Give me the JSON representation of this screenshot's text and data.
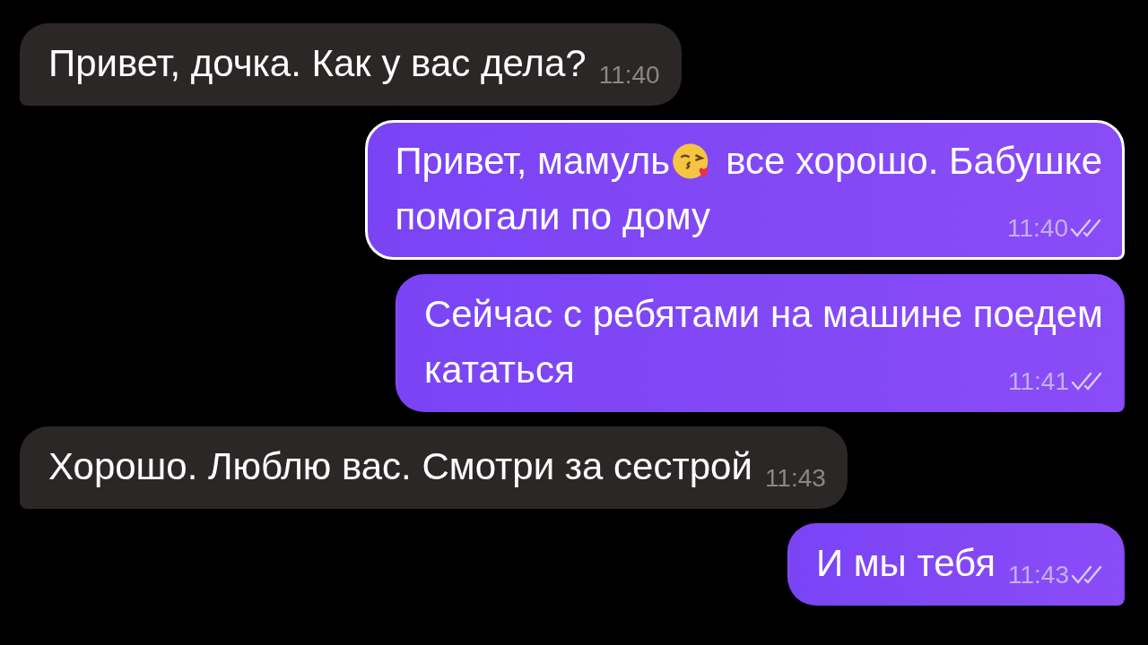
{
  "messages": [
    {
      "kind": "incoming",
      "highlighted": false,
      "lines": [
        [
          {
            "kind": "text",
            "text": "Привет, дочка. Как у вас дела?"
          }
        ]
      ],
      "time": "11:40"
    },
    {
      "kind": "outgoing",
      "highlighted": true,
      "lines": [
        [
          {
            "kind": "text",
            "text": "Привет, мамуль"
          },
          {
            "kind": "emoji"
          },
          {
            "kind": "text",
            "text": "все хорошо. Бабушке"
          }
        ],
        [
          {
            "kind": "text",
            "text": "помогали по дому"
          }
        ]
      ],
      "time": "11:40",
      "read": true
    },
    {
      "kind": "outgoing",
      "highlighted": false,
      "lines": [
        [
          {
            "kind": "text",
            "text": "Сейчас с ребятами на машине поедем"
          }
        ],
        [
          {
            "kind": "text",
            "text": "кататься"
          }
        ]
      ],
      "time": "11:41",
      "read": true
    },
    {
      "kind": "incoming",
      "highlighted": false,
      "lines": [
        [
          {
            "kind": "text",
            "text": "Хорошо. Люблю вас. Смотри за сестрой"
          }
        ]
      ],
      "time": "11:43"
    },
    {
      "kind": "outgoing",
      "highlighted": false,
      "lines": [
        [
          {
            "kind": "text",
            "text": "И мы тебя"
          }
        ]
      ],
      "time": "11:43",
      "read": true
    }
  ]
}
